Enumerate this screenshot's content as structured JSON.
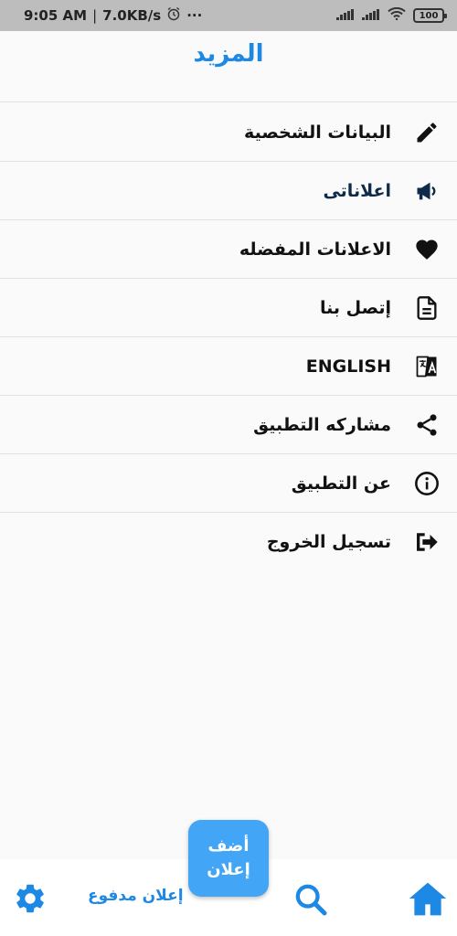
{
  "status_bar": {
    "time": "9:05 AM",
    "separator": "|",
    "speed": "7.0KB/s",
    "more": "···",
    "battery": "100"
  },
  "header": {
    "title": "المزيد"
  },
  "menu": [
    {
      "label": "البيانات الشخصية",
      "icon": "pencil-icon"
    },
    {
      "label": "اعلاناتى",
      "icon": "megaphone-icon"
    },
    {
      "label": "الاعلانات المفضله",
      "icon": "heart-icon"
    },
    {
      "label": "إتصل بنا",
      "icon": "document-icon"
    },
    {
      "label": "ENGLISH",
      "icon": "translate-icon"
    },
    {
      "label": "مشاركه التطبيق",
      "icon": "share-icon"
    },
    {
      "label": "عن التطبيق",
      "icon": "info-icon"
    },
    {
      "label": "تسجيل الخروج",
      "icon": "logout-icon"
    }
  ],
  "bottom_nav": {
    "paid_ad": "إعلان مدفوع",
    "fab_line1": "أضف",
    "fab_line2": "إعلان"
  },
  "colors": {
    "accent": "#1e88e5",
    "fab": "#42a5f5",
    "status_bar": "#bdbdbd"
  }
}
